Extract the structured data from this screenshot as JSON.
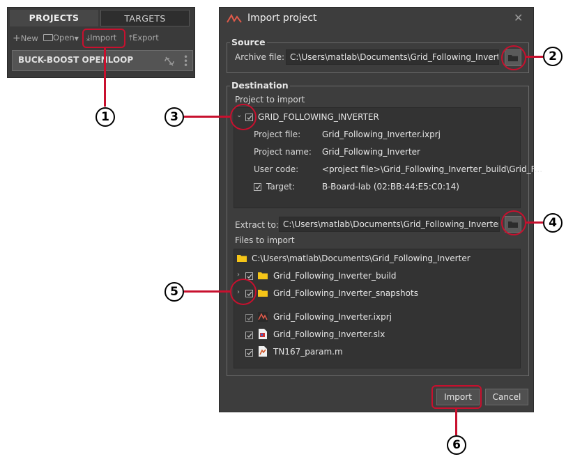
{
  "left_panel": {
    "tabs": [
      "PROJECTS",
      "TARGETS"
    ],
    "toolbar": {
      "new": "New",
      "open": "Open",
      "import": "Import",
      "export": "Export"
    },
    "project_name": "BUCK-BOOST OPENLOOP"
  },
  "dialog": {
    "title": "Import project",
    "source": {
      "legend": "Source",
      "archive_label": "Archive file:",
      "archive_value": "C:\\Users\\matlab\\Documents\\Grid_Following_Inverter.zip"
    },
    "destination": {
      "legend": "Destination",
      "project_to_import": "Project to import",
      "project_root": "GRID_FOLLOWING_INVERTER",
      "details": [
        {
          "label": "Project file:",
          "value": "Grid_Following_Inverter.ixprj"
        },
        {
          "label": "Project name:",
          "value": "Grid_Following_Inverter"
        },
        {
          "label": "User code:",
          "value": "<project file>\\Grid_Following_Inverter_build\\Grid_F..."
        },
        {
          "label": "Target:",
          "value": "B-Board-lab (02:BB:44:E5:C0:14)"
        }
      ],
      "extract_label": "Extract to:",
      "extract_value": "C:\\Users\\matlab\\Documents\\Grid_Following_Inverter",
      "files_to_import": "Files to import",
      "files_root": "C:\\Users\\matlab\\Documents\\Grid_Following_Inverter",
      "files": [
        "Grid_Following_Inverter_build",
        "Grid_Following_Inverter_snapshots",
        "Grid_Following_Inverter.ixprj",
        "Grid_Following_Inverter.slx",
        "TN167_param.m"
      ]
    },
    "buttons": {
      "import": "Import",
      "cancel": "Cancel"
    }
  },
  "callouts": [
    "1",
    "2",
    "3",
    "4",
    "5",
    "6"
  ],
  "colors": {
    "dialog_bg": "#3d3d3d",
    "highlight": "#c8102e",
    "folder": "#f5c518"
  }
}
